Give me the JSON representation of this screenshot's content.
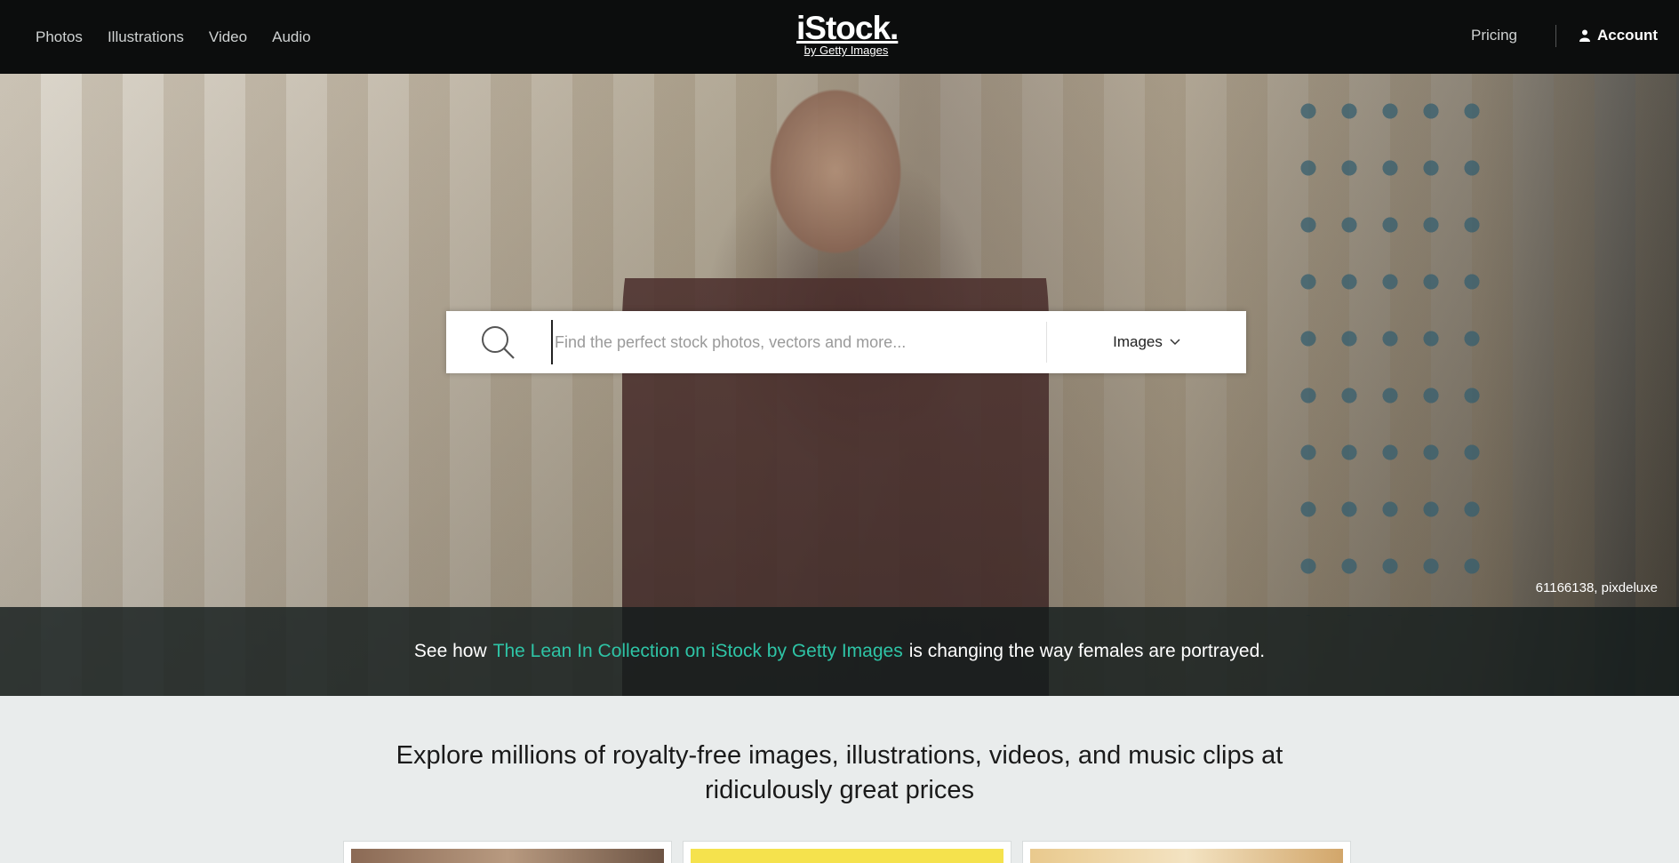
{
  "header": {
    "nav": [
      "Photos",
      "Illustrations",
      "Video",
      "Audio"
    ],
    "logo_main": "iStock.",
    "logo_sub": "by Getty Images",
    "pricing": "Pricing",
    "account": "Account"
  },
  "hero": {
    "credit": "61166138, pixdeluxe",
    "banner_prefix": "See how",
    "banner_link": "The Lean In Collection on iStock by Getty Images",
    "banner_suffix": "is changing the way females are portrayed."
  },
  "search": {
    "placeholder": "Find the perfect stock photos, vectors and more...",
    "media_type": "Images",
    "icon": "search-icon"
  },
  "main": {
    "explore_line1": "Explore millions of royalty-free images, illustrations, videos, and music clips at",
    "explore_line2": "ridiculously great prices"
  },
  "colors": {
    "header_bg": "#0c0d0d",
    "accent": "#2ec4a6",
    "page_bg": "#e9ecec"
  }
}
